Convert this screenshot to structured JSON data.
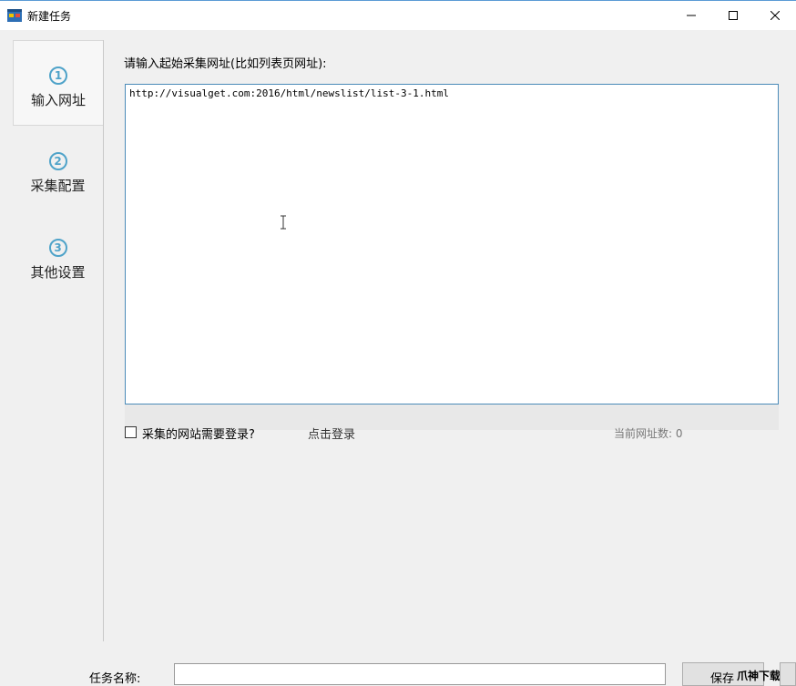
{
  "window": {
    "title": "新建任务",
    "minimize_icon": "minimize-icon",
    "maximize_icon": "maximize-icon",
    "close_icon": "close-icon"
  },
  "steps": [
    {
      "number": "1",
      "label": "输入网址",
      "active": true
    },
    {
      "number": "2",
      "label": "采集配置",
      "active": false
    },
    {
      "number": "3",
      "label": "其他设置",
      "active": false
    }
  ],
  "url_section": {
    "prompt": "请输入起始采集网址(比如列表页网址):",
    "value": "http://visualget.com:2016/html/newslist/list-3-1.html"
  },
  "login": {
    "checkbox_label": "采集的网站需要登录?",
    "checked": false,
    "link": "点击登录"
  },
  "url_count": "当前网址数: 0",
  "footer": {
    "task_name_label": "任务名称:",
    "task_name_value": "",
    "save_label": "保存",
    "watermark": "爪神下载网"
  },
  "colors": {
    "accent": "#4fa3c9",
    "input_border": "#4a8ab8"
  }
}
